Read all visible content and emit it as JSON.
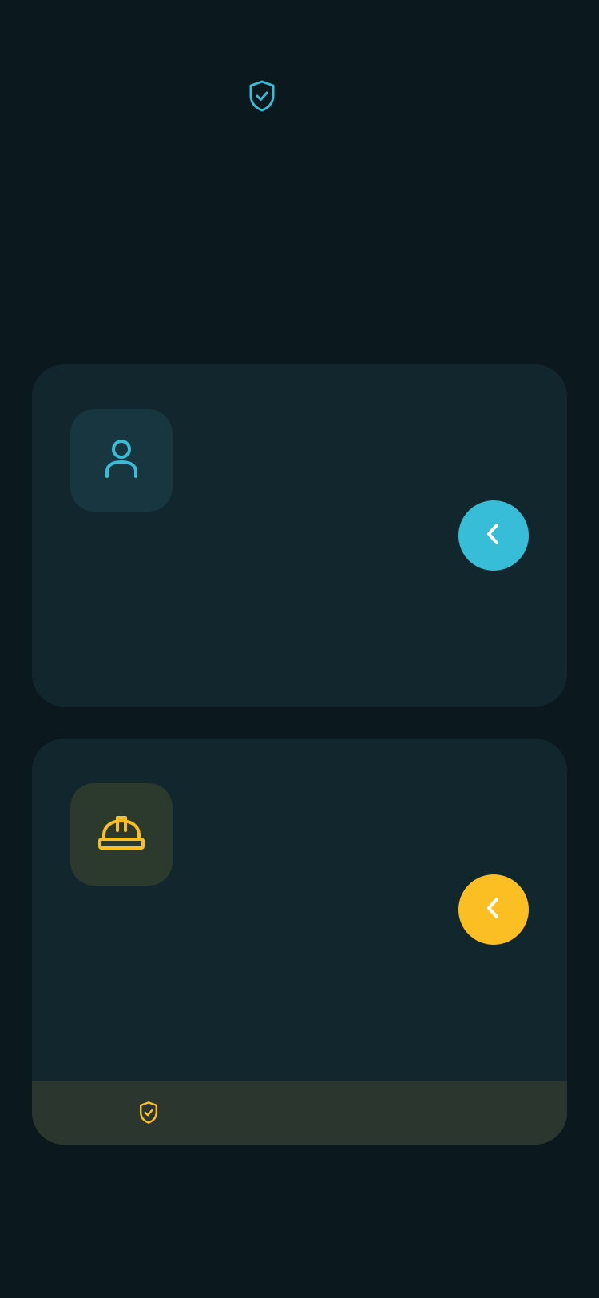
{
  "header": {
    "icon": "shield-check-icon",
    "accent": "#38bdd8"
  },
  "cards": [
    {
      "id": "worker",
      "icon": "user-icon",
      "accent": "#38bdd8",
      "title": "",
      "description": "",
      "action_icon": "chevron-left-icon"
    },
    {
      "id": "contractor",
      "icon": "hard-hat-icon",
      "accent": "#fbbf24",
      "title": "",
      "description": "",
      "action_icon": "chevron-left-icon",
      "footer": {
        "icon": "shield-check-icon",
        "text": ""
      }
    }
  ],
  "colors": {
    "background": "#0b181d",
    "card": "#12262d",
    "primary": "#38bdd8",
    "secondary": "#fbbf24"
  }
}
